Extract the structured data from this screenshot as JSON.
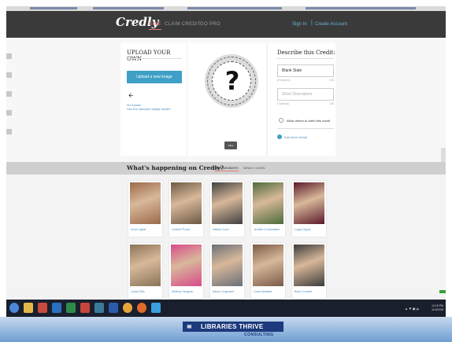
{
  "nav": {
    "logo": "Credly",
    "links": [
      "GIVE",
      "CLAIM CREDIT",
      "GO PRO"
    ],
    "signin": "Sign In",
    "separator": "|",
    "create": "Create Account"
  },
  "upload": {
    "heading": "UPLOAD YOUR OWN",
    "button": "Upload a new image",
    "line1": "No thanks",
    "line2": "Use the standard badge builder"
  },
  "badge": {
    "symbol": "?",
    "save": "Save"
  },
  "describe": {
    "heading": "Describe this Credit:",
    "title_value": "Blank Slate",
    "title_hint": "(Required)",
    "title_count": "105",
    "desc_placeholder": "Short Description",
    "desc_hint": "(Optional)",
    "desc_count": "128",
    "allow_label": "Allow others to claim this credit",
    "add_more": "Add More Detail"
  },
  "happening": {
    "title": "What's happening on Credly?",
    "tabs": [
      "NEW MEMBERS",
      "NEWLY GIVEN"
    ]
  },
  "members": [
    {
      "name": "Scott Lagbie",
      "bg": "#9b6a4a"
    },
    {
      "name": "Chantel Picard",
      "bg": "#6d5a45"
    },
    {
      "name": "Nathan Dunn",
      "bg": "#404040"
    },
    {
      "name": "Jennifer Kundrotakee",
      "bg": "#4d6b3a"
    },
    {
      "name": "Logan Hayes",
      "bg": "#5a1a2a"
    },
    {
      "name": "James Ellis",
      "bg": "#8a7458"
    },
    {
      "name": "Whitney Vaughan",
      "bg": "#d84a8a"
    },
    {
      "name": "Naomi Jorgensen",
      "bg": "#6a6f78"
    },
    {
      "name": "Grant Seelaide",
      "bg": "#7a5a48"
    },
    {
      "name": "Brian Crockett",
      "bg": "#3c3c3c"
    }
  ],
  "taskbar": {
    "tray": "▲ ⚑ ▣ 🔈",
    "time": "12:18 PM",
    "date": "11/4/2015"
  },
  "footer": {
    "brand": "LIBRARIES THRIVE",
    "sub": "CONSULTING"
  },
  "colors": {
    "accent": "#3ea0c7",
    "nav_active": "#e77c7c",
    "link": "#6bb2d6",
    "footer_brand": "#1c3a7c"
  }
}
